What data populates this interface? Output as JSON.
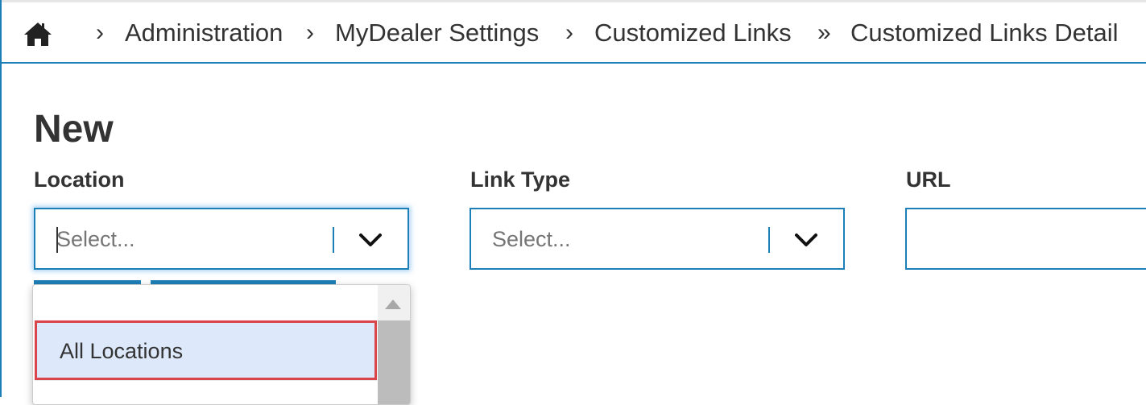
{
  "breadcrumb": {
    "home_icon": "home-icon",
    "items": [
      {
        "label": "Administration",
        "separator": "›"
      },
      {
        "label": "MyDealer Settings",
        "separator": "›"
      },
      {
        "label": "Customized Links",
        "separator": "›"
      },
      {
        "label": "Customized Links Detail",
        "separator": "»"
      }
    ]
  },
  "page": {
    "title": "New"
  },
  "form": {
    "location": {
      "label": "Location",
      "placeholder": "Select...",
      "value": ""
    },
    "link_type": {
      "label": "Link Type",
      "placeholder": "Select...",
      "value": ""
    },
    "url": {
      "label": "URL",
      "value": ""
    }
  },
  "location_dropdown": {
    "options": [
      {
        "label": "All Locations",
        "highlighted": true
      }
    ]
  },
  "colors": {
    "accent": "#1d7fb8",
    "highlight_bg": "#dde9fb",
    "highlight_border": "#d9454a",
    "text": "#333333",
    "placeholder": "#757575"
  }
}
